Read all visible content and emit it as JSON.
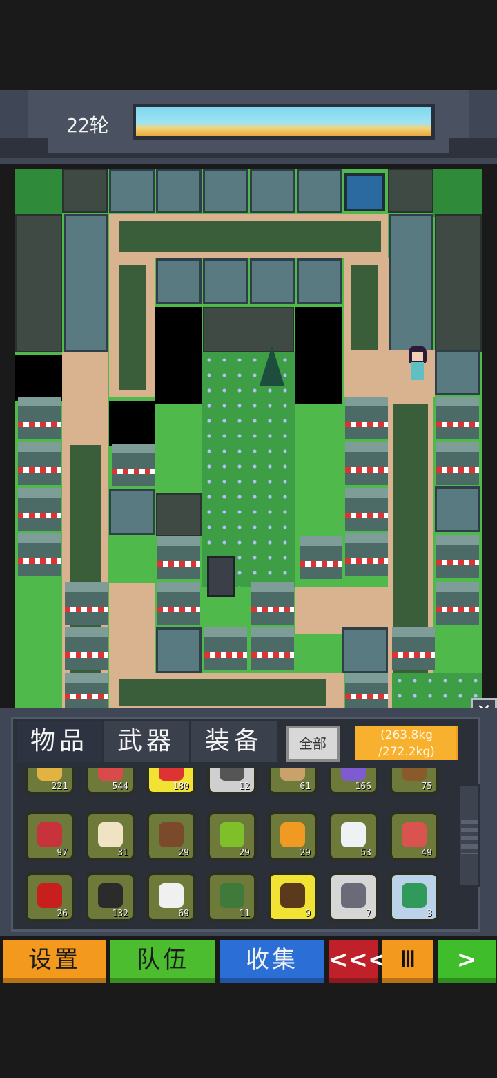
{
  "hud": {
    "round_label": "22轮"
  },
  "tabs": [
    {
      "label": "物品",
      "active": true
    },
    {
      "label": "武器",
      "active": false
    },
    {
      "label": "装备",
      "active": false
    }
  ],
  "filter": {
    "label": "全部"
  },
  "weight": {
    "current": "(263.8kg",
    "max": "/272.2kg)",
    "fill_fraction": 0.97
  },
  "inventory": {
    "rows": [
      [
        {
          "icon": "canned-food-icon",
          "count": "221",
          "style": "normal"
        },
        {
          "icon": "medkit-icon",
          "count": "544",
          "style": "normal"
        },
        {
          "icon": "pill-icon",
          "count": "180",
          "style": "yellow"
        },
        {
          "icon": "rifle-barrel-icon",
          "count": "12",
          "style": "grey"
        },
        {
          "icon": "rope-icon",
          "count": "61",
          "style": "normal"
        },
        {
          "icon": "cloth-icon",
          "count": "166",
          "style": "normal"
        },
        {
          "icon": "wood-log-icon",
          "count": "75",
          "style": "normal"
        }
      ],
      [
        {
          "icon": "meat-icon",
          "count": "97",
          "style": "normal"
        },
        {
          "icon": "egg-icon",
          "count": "31",
          "style": "normal"
        },
        {
          "icon": "chocolate-icon",
          "count": "29",
          "style": "normal"
        },
        {
          "icon": "apple-icon",
          "count": "29",
          "style": "normal"
        },
        {
          "icon": "honeycomb-icon",
          "count": "29",
          "style": "normal"
        },
        {
          "icon": "milk-bottle-icon",
          "count": "53",
          "style": "normal"
        },
        {
          "icon": "canned-fish-icon",
          "count": "49",
          "style": "normal"
        }
      ],
      [
        {
          "icon": "chili-icon",
          "count": "26",
          "style": "normal"
        },
        {
          "icon": "battery-icon",
          "count": "132",
          "style": "normal"
        },
        {
          "icon": "cloth-bag-icon",
          "count": "69",
          "style": "normal"
        },
        {
          "icon": "herb-icon",
          "count": "11",
          "style": "normal"
        },
        {
          "icon": "liquor-bottle-icon",
          "count": "9",
          "style": "yellow"
        },
        {
          "icon": "gun-icon",
          "count": "7",
          "style": "white"
        },
        {
          "icon": "circuit-board-icon",
          "count": "3",
          "style": "light"
        }
      ]
    ]
  },
  "bottom_buttons": [
    {
      "label": "设置",
      "color": "#f39a1e"
    },
    {
      "label": "队伍",
      "color": "#4bbd2f"
    },
    {
      "label": "收集",
      "color": "#2b6fd6"
    },
    {
      "label": "<<<",
      "color": "#c0202a"
    },
    {
      "label": "Ⅲ",
      "color": "#f39a1e"
    },
    {
      "label": ">",
      "color": "#3fbd2a"
    }
  ]
}
